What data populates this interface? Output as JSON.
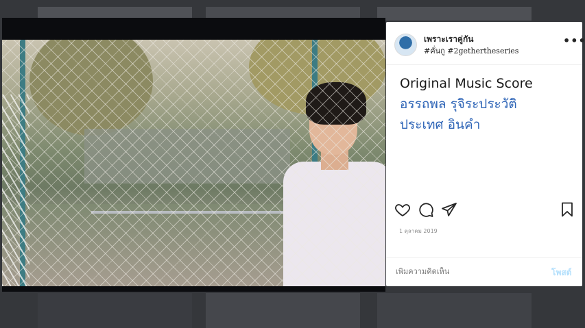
{
  "post": {
    "username": "เพราะเราคู่กัน",
    "hashtags": "#คั่นกู #2gethertheseries",
    "more_label": "•••",
    "caption_lines": [
      "Original Music Score",
      "อรรถพล รุจิระประวัติ",
      "ประเทศ อินคำ"
    ],
    "date": "1 ตุลาคม 2019",
    "comment_placeholder": "เพิ่มความคิดเห็น",
    "post_button_label": "โพสต์"
  },
  "icons": {
    "like": "heart-icon",
    "comment": "comment-icon",
    "share": "send-icon",
    "save": "bookmark-icon"
  },
  "colors": {
    "link_blue": "#2f65b7",
    "post_button": "#b2dffc",
    "backdrop": "#2b2d31"
  }
}
